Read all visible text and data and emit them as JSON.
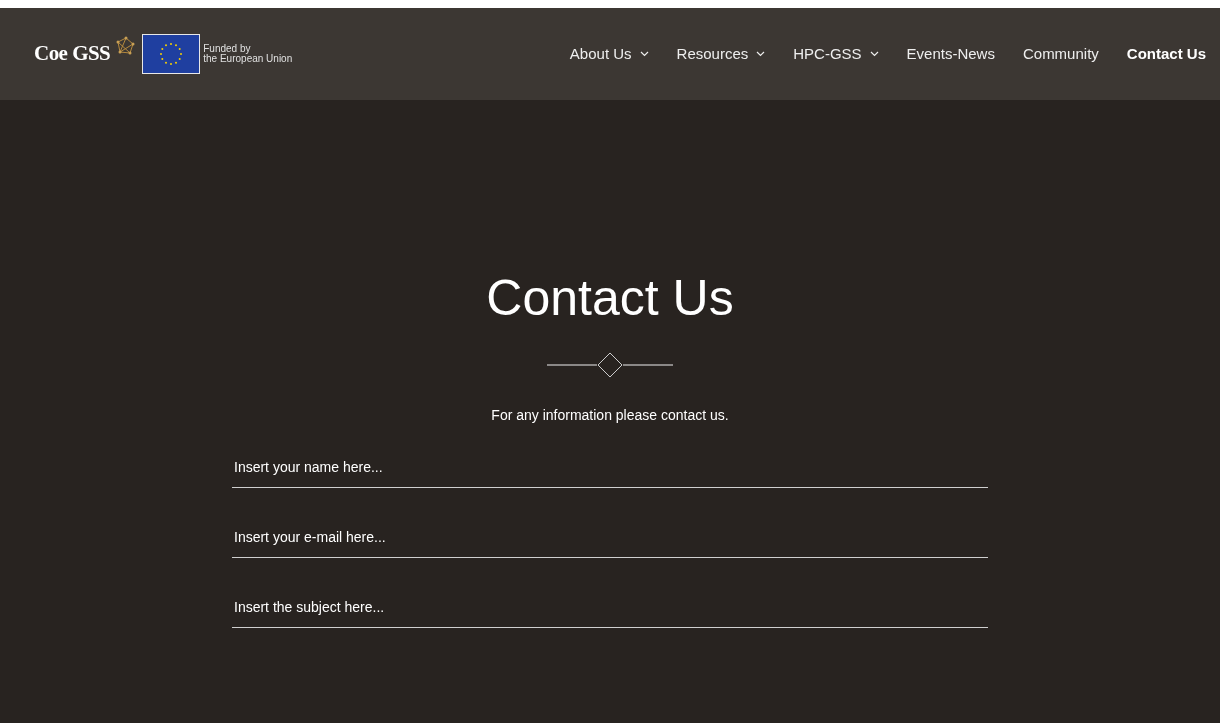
{
  "header": {
    "logo": "Coe GSS",
    "eu_text": [
      "Funded by",
      "the European Union"
    ],
    "nav": [
      {
        "label": "About Us",
        "has_dropdown": true,
        "selected": false
      },
      {
        "label": "Resources",
        "has_dropdown": true,
        "selected": false
      },
      {
        "label": "HPC-GSS",
        "has_dropdown": true,
        "selected": false
      },
      {
        "label": "Events-News",
        "has_dropdown": false,
        "selected": false
      },
      {
        "label": "Community",
        "has_dropdown": false,
        "selected": false
      },
      {
        "label": "Contact Us",
        "has_dropdown": false,
        "selected": true
      }
    ]
  },
  "main": {
    "title": "Contact Us",
    "intro": "For any information please contact us.",
    "fields": [
      {
        "placeholder": "Insert your name here..."
      },
      {
        "placeholder": "Insert your e-mail here..."
      },
      {
        "placeholder": "Insert the subject here..."
      }
    ]
  }
}
